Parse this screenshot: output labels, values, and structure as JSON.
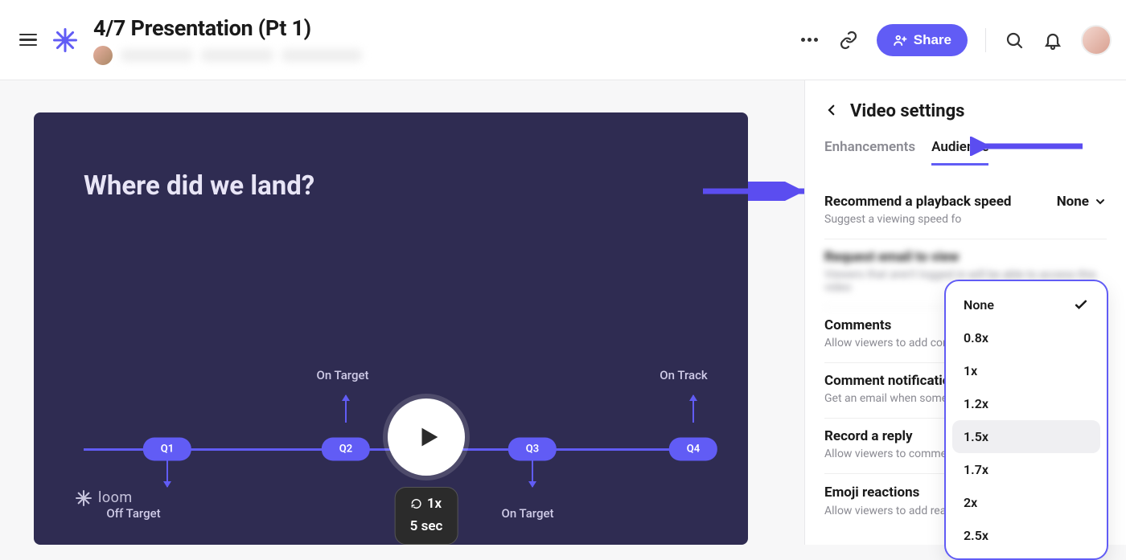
{
  "header": {
    "title": "4/7 Presentation (Pt 1)",
    "share_label": "Share"
  },
  "video": {
    "slide_title": "Where did we land?",
    "q1": "Q1",
    "q2": "Q2",
    "q3": "Q3",
    "q4": "Q4",
    "q1_label": "Off Target",
    "q2_label": "On Target",
    "q3_label": "On Target",
    "q4_label": "On Track",
    "speed_badge": "1x",
    "time_badge": "5 sec",
    "brand": "loom"
  },
  "sidebar": {
    "title": "Video settings",
    "tabs": {
      "enhancements": "Enhancements",
      "audience": "Audience"
    },
    "playback": {
      "label": "Recommend a playback speed",
      "desc": "Suggest a viewing speed fo",
      "value": "None",
      "options": [
        "None",
        "0.8x",
        "1x",
        "1.2x",
        "1.5x",
        "1.7x",
        "2x",
        "2.5x"
      ],
      "selected": "None",
      "hover": "1.5x"
    },
    "request_email": {
      "label": "Request email to view",
      "desc": "Viewers that aren't logged in will be able to access this video"
    },
    "comments": {
      "label": "Comments",
      "desc": "Allow viewers to add comm"
    },
    "notifications": {
      "label": "Comment notification",
      "desc": "Get an email when someon"
    },
    "reply": {
      "label": "Record a reply",
      "desc": "Allow viewers to comment"
    },
    "emoji": {
      "label": "Emoji reactions",
      "desc": "Allow viewers to add reactions"
    }
  }
}
